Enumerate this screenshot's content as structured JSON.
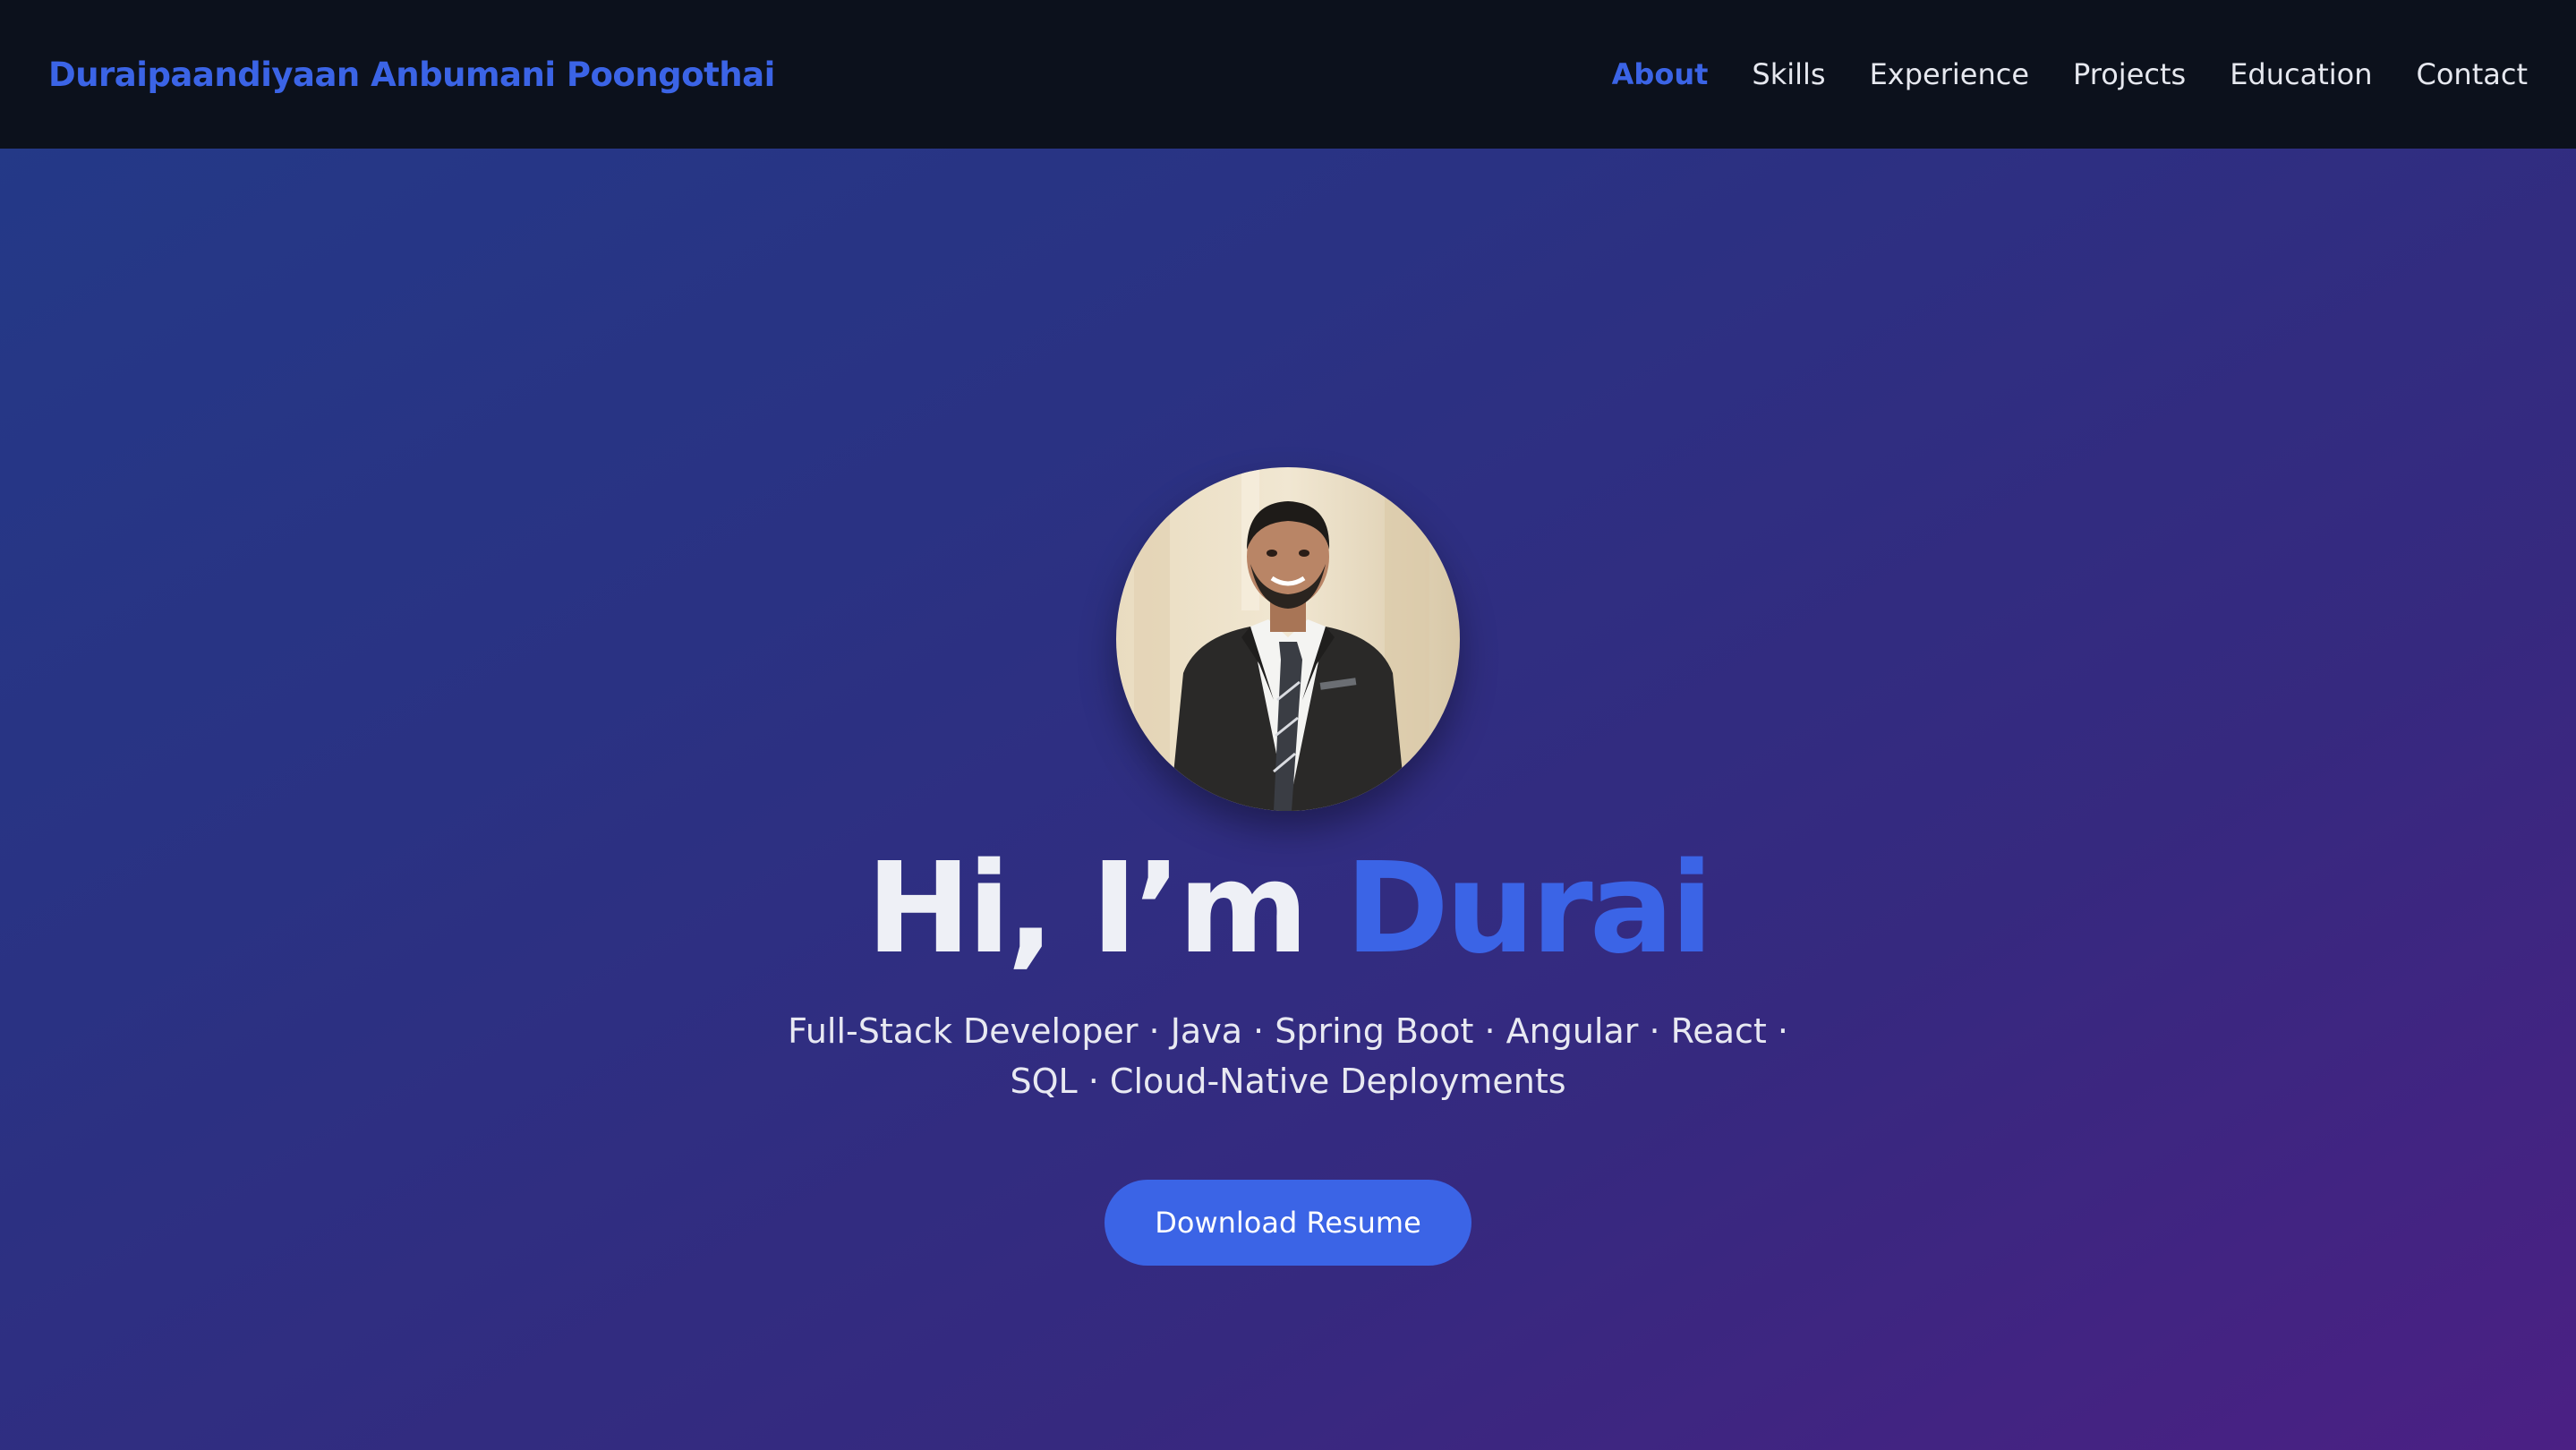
{
  "brand": {
    "name": "Duraipaandiyaan Anbumani Poongothai"
  },
  "nav": {
    "items": [
      {
        "label": "About",
        "active": true
      },
      {
        "label": "Skills"
      },
      {
        "label": "Experience"
      },
      {
        "label": "Projects"
      },
      {
        "label": "Education"
      },
      {
        "label": "Contact"
      }
    ]
  },
  "hero": {
    "greeting": "Hi, I’m ",
    "name": "Durai",
    "tagline": "Full-Stack Developer · Java · Spring Boot · Angular · React · SQL · Cloud-Native Deployments",
    "cta_label": "Download Resume"
  },
  "colors": {
    "accent": "#3b64e6",
    "navbar_bg": "#0c111c",
    "hero_gradient_start": "#233a88",
    "hero_gradient_end": "#4b2084"
  }
}
